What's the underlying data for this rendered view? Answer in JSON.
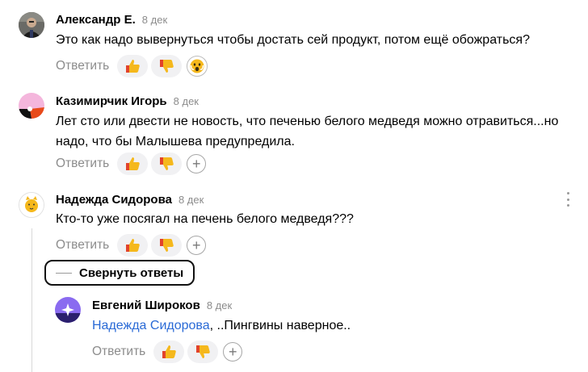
{
  "labels": {
    "reply": "Ответить",
    "collapse": "Свернуть ответы"
  },
  "comments": [
    {
      "author": "Александр Е.",
      "date": "8 дек",
      "text": "Это как надо вывернуться чтобы достать сей продукт, потом ещё обожраться?",
      "extra_reaction": "scared-face-icon"
    },
    {
      "author": "Казимирчик Игорь",
      "date": "8 дек",
      "text_line1": "Лет сто или двести не новость, что печенью белого медведя можно отравиться...но",
      "text_line2": "надо, что бы Малышева предупредила."
    },
    {
      "author": "Надежда Сидорова",
      "date": "8 дек",
      "text": "Кто-то уже посягал на печень белого медведя???"
    }
  ],
  "reply": {
    "author": "Евгений Широков",
    "date": "8 дек",
    "mention": "Надежда Сидорова",
    "text": ", ..Пингвины наверное.."
  },
  "colors": {
    "accent_link": "#2a6ad6",
    "thumb_yellow": "#f5b81c",
    "thumb_red": "#e2432c"
  }
}
